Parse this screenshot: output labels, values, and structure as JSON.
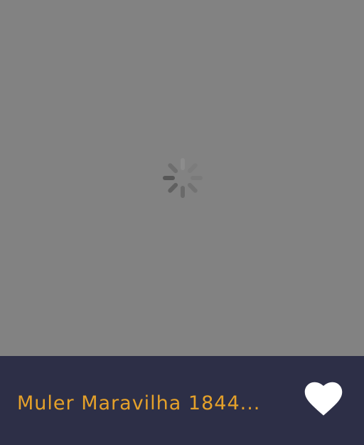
{
  "media": {
    "state": "loading",
    "spinner_icon": "loading-spinner-icon",
    "placeholder_color": "#828282"
  },
  "bottom_bar": {
    "title": "Muler Maravilha 1844...",
    "favorite_icon": "heart-icon",
    "background_color": "#2d2f47",
    "title_color": "#e5a12a",
    "favorite_color": "#ffffff"
  }
}
